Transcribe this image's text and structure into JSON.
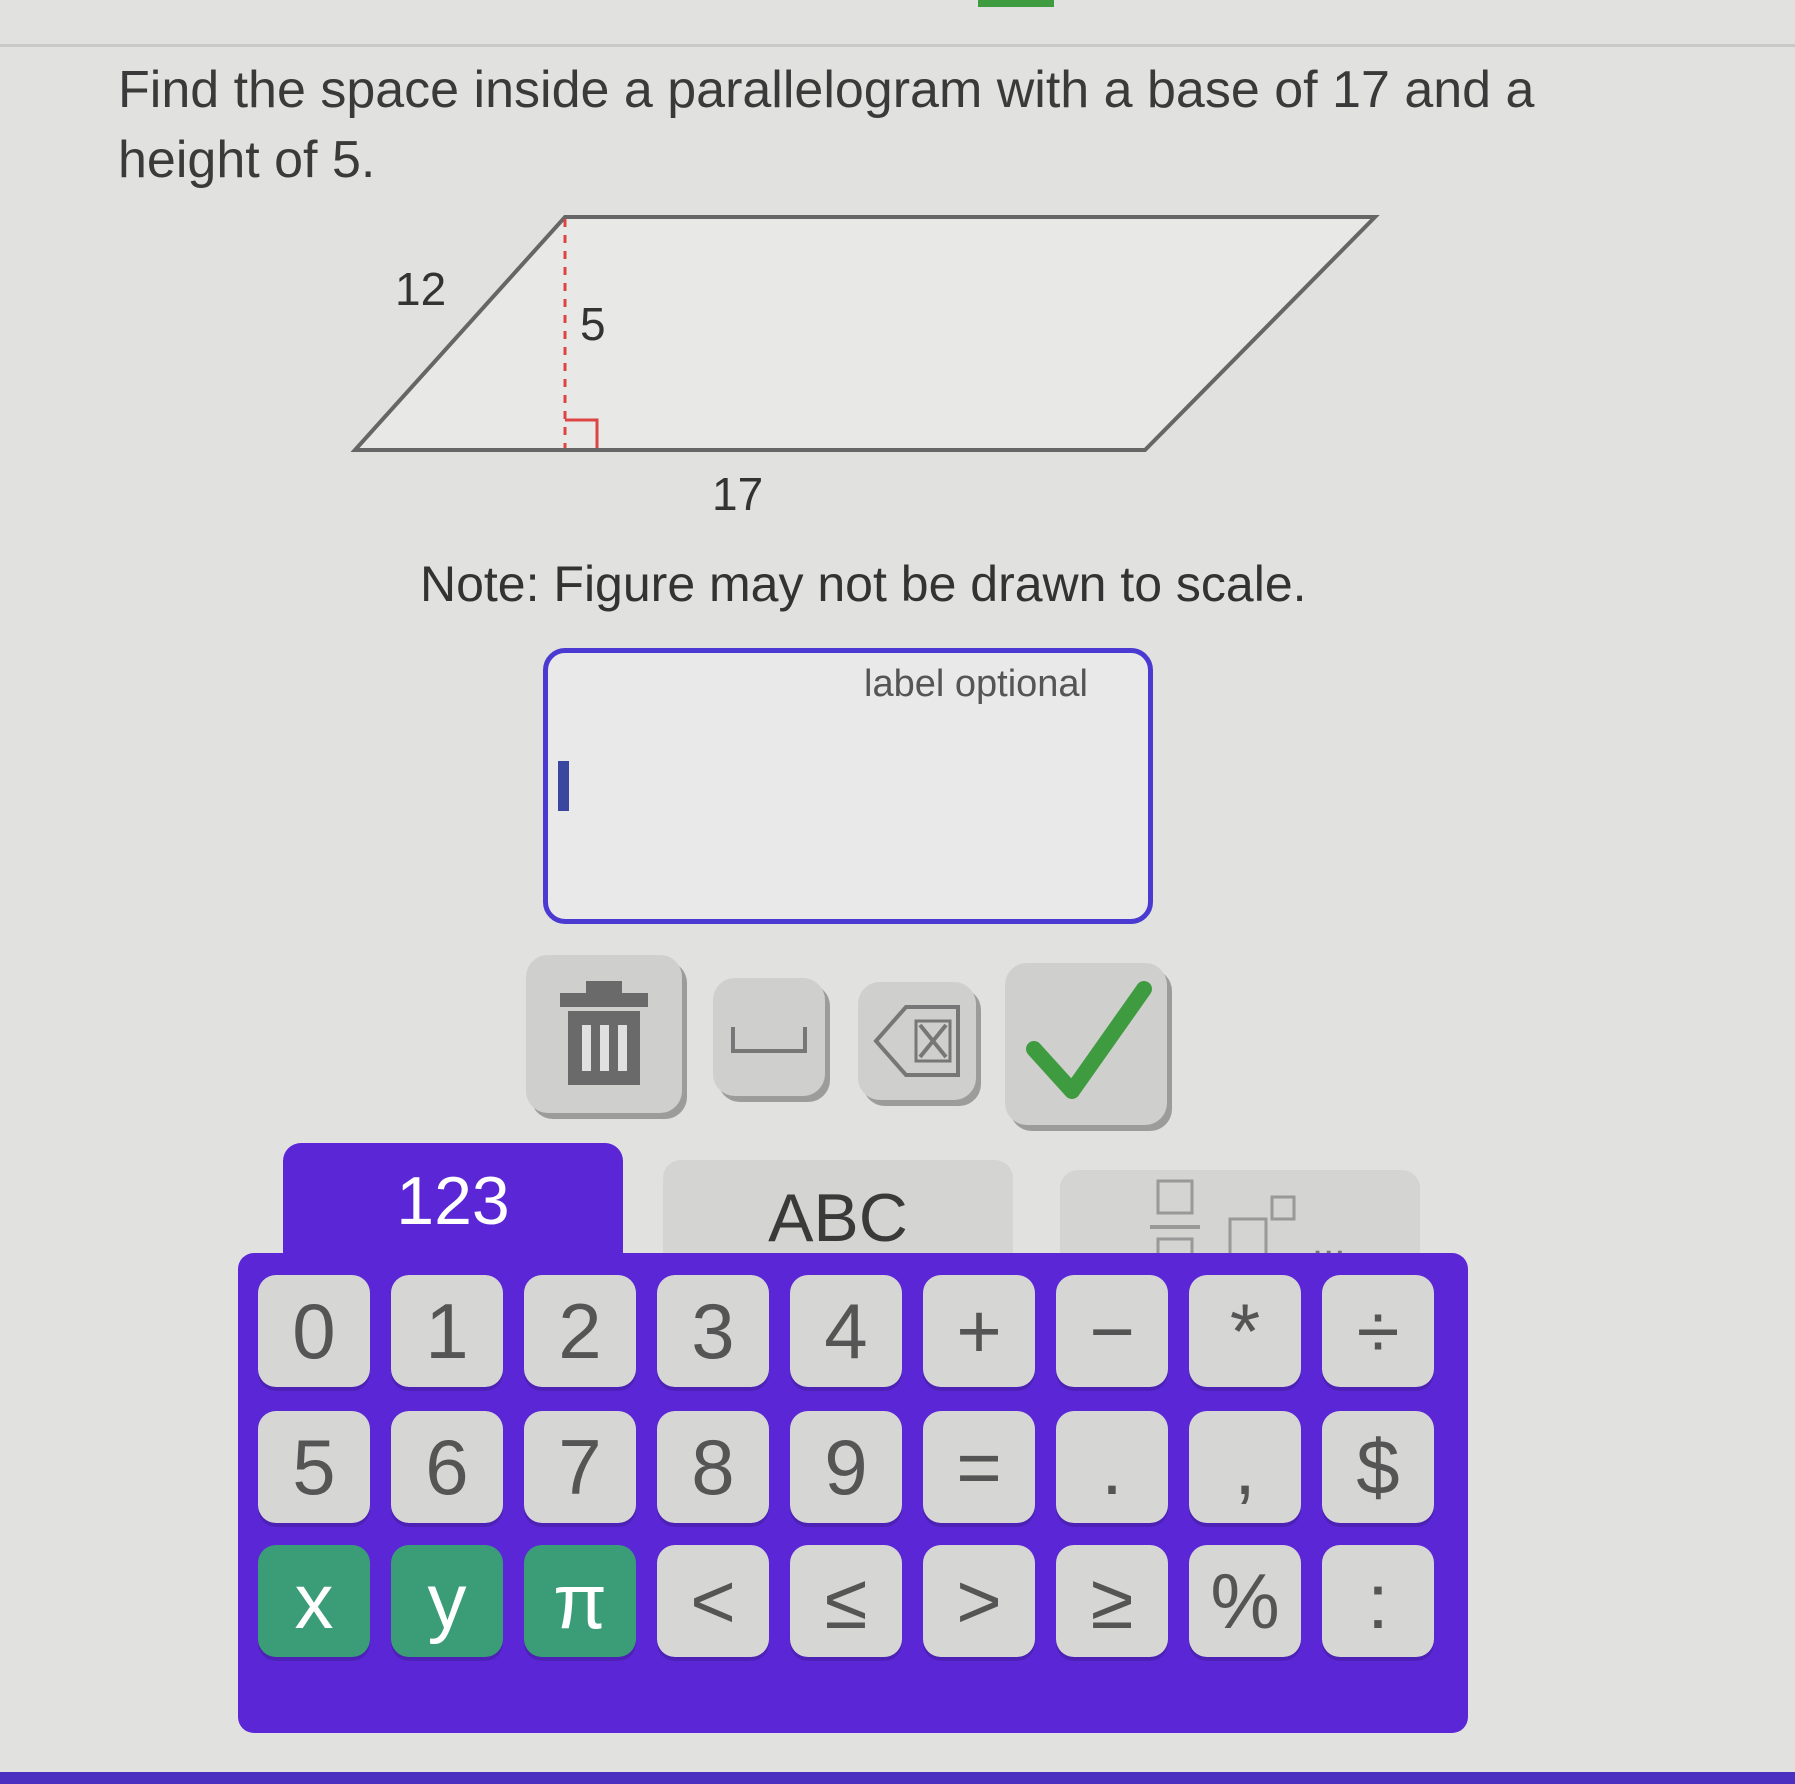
{
  "question": {
    "text": "Find the space inside a parallelogram with a base of 17 and a height of 5."
  },
  "figure": {
    "side_label": "12",
    "height_label": "5",
    "base_label": "17",
    "note": "Note: Figure may not be drawn to scale."
  },
  "answer": {
    "placeholder": "label optional",
    "value": ""
  },
  "toolbar": {
    "clear_icon": "trash-icon",
    "space_icon": "space-bar-icon",
    "backspace_icon": "backspace-icon",
    "submit_icon": "checkmark-icon",
    "submit_color": "#3f9b3f"
  },
  "tabs": {
    "numbers": "123",
    "letters": "ABC",
    "more_ellipsis": "..."
  },
  "keypad": {
    "accent_color": "#5b27d6",
    "rows": [
      [
        "0",
        "1",
        "2",
        "3",
        "4",
        "+",
        "−",
        "*",
        "÷"
      ],
      [
        "5",
        "6",
        "7",
        "8",
        "9",
        "=",
        ".",
        ",",
        "$"
      ],
      [
        "x",
        "y",
        "π",
        "<",
        "≤",
        ">",
        "≥",
        "%",
        ":"
      ]
    ]
  }
}
